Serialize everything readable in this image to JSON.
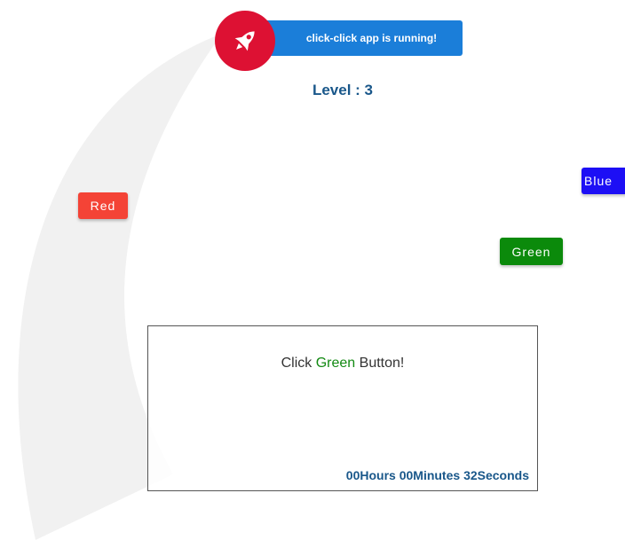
{
  "banner": {
    "text": "click-click app is running!",
    "icon": "rocket-icon",
    "colors": {
      "banner_bg": "#1b7ed9",
      "badge_bg": "#dd1133"
    }
  },
  "level": {
    "label": "Level : 3"
  },
  "buttons": {
    "red": {
      "label": "Red",
      "color": "#f44336"
    },
    "green": {
      "label": "Green",
      "color": "#0b8a0b"
    },
    "blue": {
      "label": "Blue",
      "color": "#1d0ff5"
    }
  },
  "panel": {
    "instruction_prefix": "Click ",
    "instruction_color_word": "Green",
    "instruction_suffix": " Button!",
    "timer": {
      "hours": "00",
      "hours_unit": "Hours",
      "minutes": "00",
      "minutes_unit": "Minutes",
      "seconds": "32",
      "seconds_unit": "Seconds"
    }
  }
}
